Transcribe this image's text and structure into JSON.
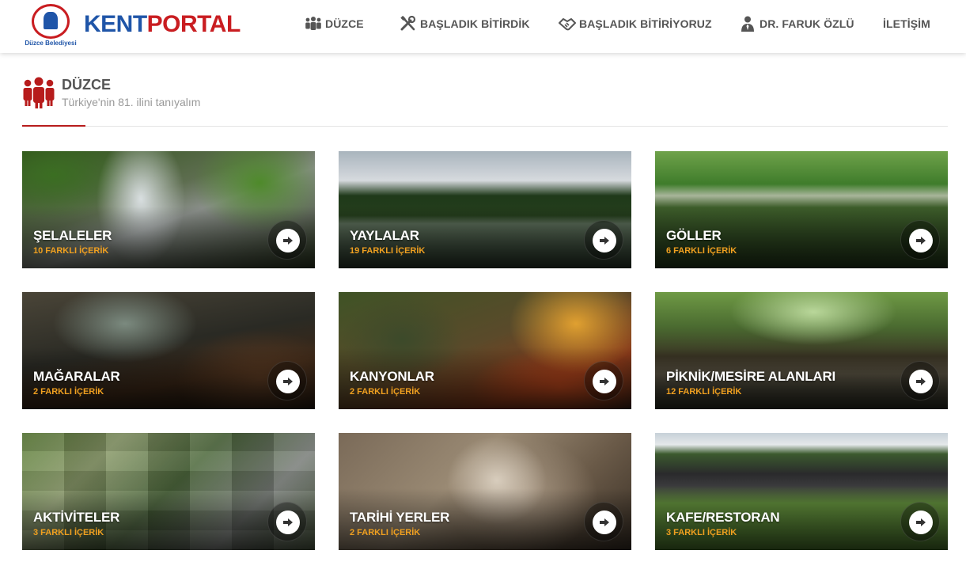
{
  "header": {
    "logo": {
      "word_kent": "KENT",
      "word_portal": "PORTAL",
      "emblem_city": "Düzce Belediyesi"
    },
    "nav": [
      {
        "label": "DÜZCE",
        "icon": "people-icon"
      },
      {
        "label": "BAŞLADIK BİTİRDİK",
        "icon": "tools-icon"
      },
      {
        "label": "BAŞLADIK BİTİRİYORUZ",
        "icon": "handshake-icon"
      },
      {
        "label": "DR. FARUK ÖZLÜ",
        "icon": "user-tie-icon"
      },
      {
        "label": "İLETİŞİM",
        "icon": ""
      }
    ]
  },
  "section": {
    "icon": "people-icon",
    "title": "DÜZCE",
    "subtitle": "Türkiye'nin 81. ilini tanıyalım"
  },
  "cards": [
    {
      "title": "ŞELALELER",
      "count": "10 FARKLI İÇERİK"
    },
    {
      "title": "YAYLALAR",
      "count": "19 FARKLI İÇERİK"
    },
    {
      "title": "GÖLLER",
      "count": "6 FARKLI İÇERİK"
    },
    {
      "title": "MAĞARALAR",
      "count": "2 FARKLI İÇERİK"
    },
    {
      "title": "KANYONLAR",
      "count": "2 FARKLI İÇERİK"
    },
    {
      "title": "PİKNİK/MESİRE ALANLARI",
      "count": "12 FARKLI İÇERİK"
    },
    {
      "title": "AKTİVİTELER",
      "count": "3 FARKLI İÇERİK"
    },
    {
      "title": "TARİHİ YERLER",
      "count": "2 FARKLI İÇERİK"
    },
    {
      "title": "KAFE/RESTORAN",
      "count": "3 FARKLI İÇERİK"
    }
  ],
  "colors": {
    "brand_blue": "#1f55a8",
    "brand_red": "#c91d21",
    "accent_dark_red": "#b71c1c",
    "count_orange": "#f0a020",
    "nav_text": "#555555"
  }
}
